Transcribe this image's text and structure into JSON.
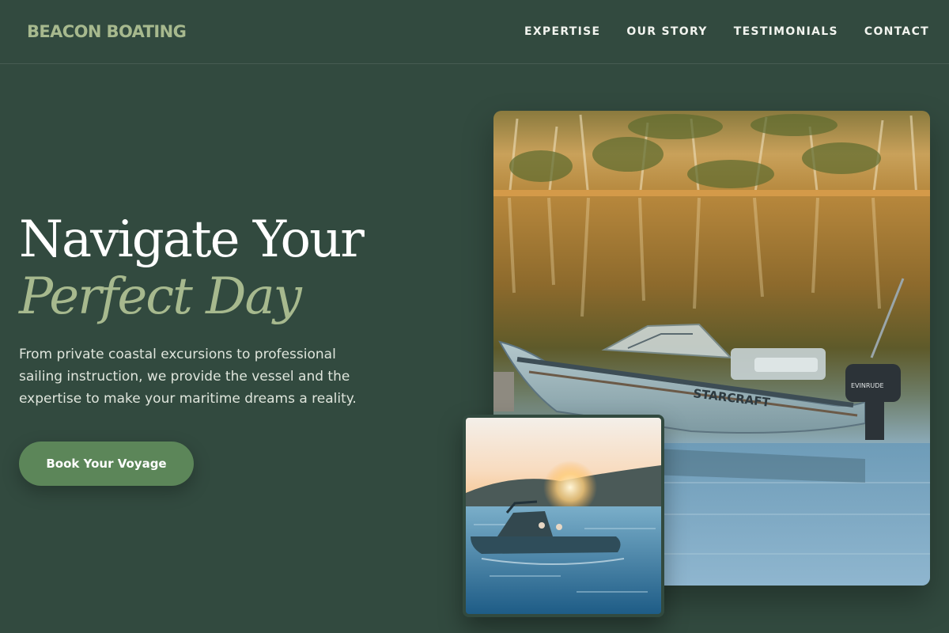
{
  "brand": {
    "name": "BEACON BOATING",
    "color": "#a7b98e"
  },
  "nav": {
    "items": [
      {
        "label": "EXPERTISE"
      },
      {
        "label": "OUR STORY"
      },
      {
        "label": "TESTIMONIALS"
      },
      {
        "label": "CONTACT"
      }
    ]
  },
  "hero": {
    "title_line1": "Navigate Your",
    "title_line2": "Perfect Day",
    "description": "From private coastal excursions to professional sailing instruction, we provide the vessel and the expertise to make your maritime dreams a reality.",
    "cta_label": "Book Your Voyage"
  },
  "images": {
    "main": {
      "boat_name": "STARCRAFT",
      "motor_brand": "EVINRUDE"
    }
  },
  "colors": {
    "background": "#324a3f",
    "accent": "#a7b98e",
    "button": "#5c8659",
    "text": "#ffffff"
  }
}
